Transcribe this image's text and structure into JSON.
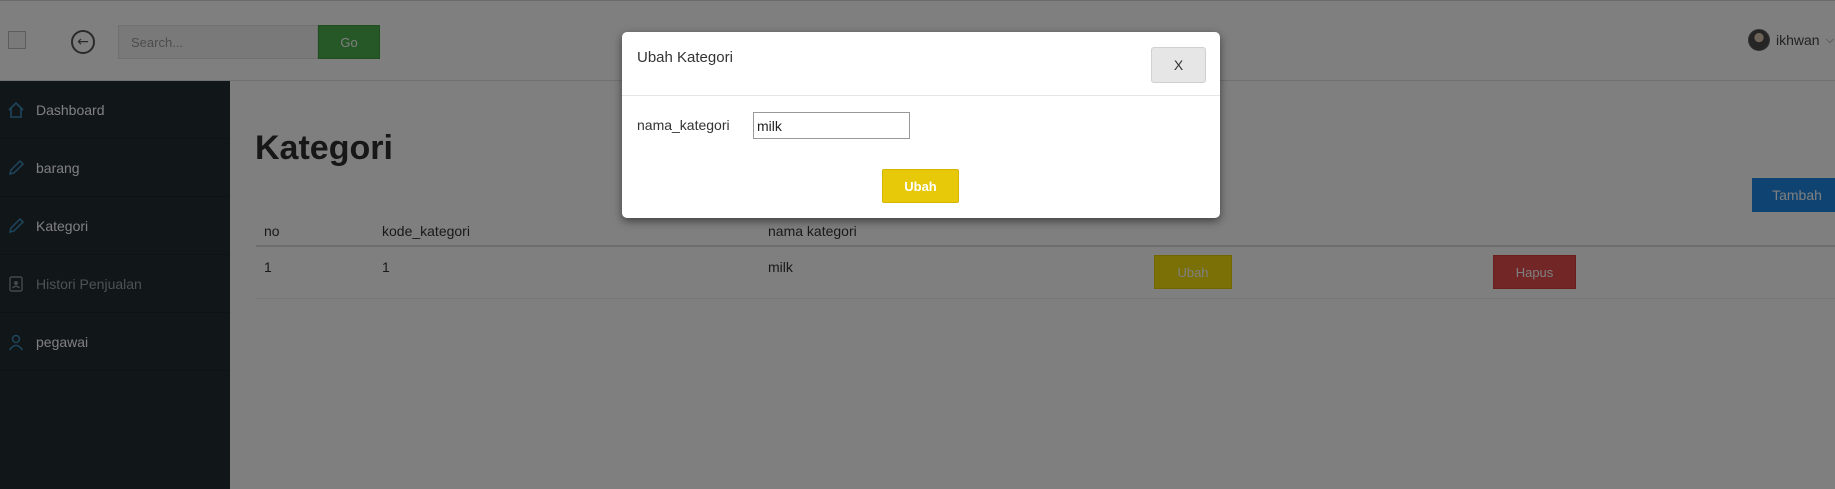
{
  "header": {
    "search": {
      "placeholder": "Search...",
      "value": ""
    },
    "go_label": "Go",
    "user_name": "ikhwan"
  },
  "sidebar": {
    "items": [
      {
        "label": "Dashboard",
        "icon": "home-icon"
      },
      {
        "label": "barang",
        "icon": "pencil-icon"
      },
      {
        "label": "Kategori",
        "icon": "pencil-icon"
      },
      {
        "label": "Histori Penjualan",
        "icon": "contact-book-icon"
      },
      {
        "label": "pegawai",
        "icon": "user-icon"
      }
    ]
  },
  "main": {
    "title": "Kategori",
    "tambah_label": "Tambah",
    "table": {
      "headers": [
        "no",
        "kode_kategori",
        "nama kategori"
      ],
      "rows": [
        {
          "no": "1",
          "kode": "1",
          "nama": "milk",
          "ubah": "Ubah",
          "hapus": "Hapus"
        }
      ]
    }
  },
  "modal": {
    "title": "Ubah Kategori",
    "close_label": "X",
    "field_label": "nama_kategori",
    "field_value": "milk",
    "submit_label": "Ubah"
  },
  "colors": {
    "sidebar_bg": "#222d32",
    "accent_blue": "#1e88e5",
    "go_green": "#4cae4c",
    "ubah_yellow": "#f4e00c",
    "hapus_red": "#e74c4c"
  }
}
